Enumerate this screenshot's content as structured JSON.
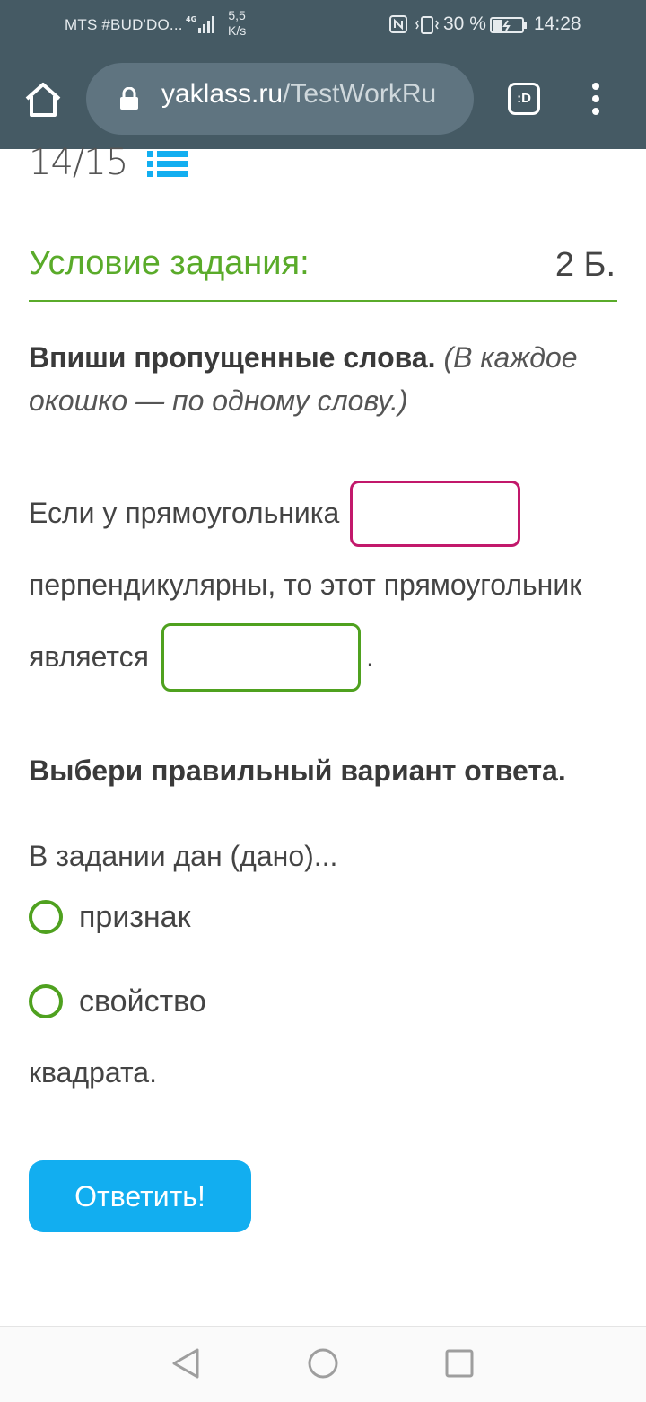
{
  "status_bar": {
    "carrier": "MTS #BUD'DO...",
    "network": "4G",
    "speed_value": "5,5",
    "speed_unit": "K/s",
    "battery": "30 %",
    "time": "14:28"
  },
  "browser": {
    "url_host": "yaklass.ru",
    "url_path": "/TestWorkRu",
    "tab_label": ":D"
  },
  "test": {
    "progress": "14/15"
  },
  "task": {
    "title": "Условие задания:",
    "points": "2 Б.",
    "instruction_bold": "Впиши пропущенные слова.",
    "instruction_italic": "(В каждое окошко — по одному слову.)",
    "line1": "Если у прямоугольника",
    "line2": "перпендикулярны, то этот прямоугольник",
    "line3": "является",
    "line3_end": ".",
    "choose_title": "Выбери правильный вариант ответа.",
    "question": "В задании дан (дано)...",
    "options": [
      "признак",
      "свойство"
    ],
    "tail": "квадрата.",
    "submit_label": "Ответить!"
  },
  "colors": {
    "toolbar": "#455a64",
    "green_accent": "#5aab2a",
    "pink_border": "#c2186b",
    "button_blue": "#12aef0"
  }
}
